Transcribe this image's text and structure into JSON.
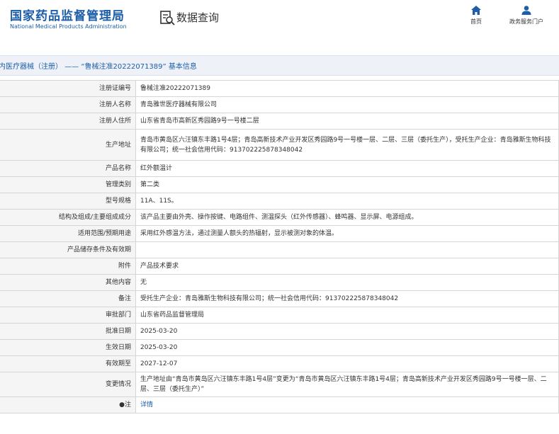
{
  "header": {
    "logo_cn": "国家药品监督管理局",
    "logo_en": "National Medical Products Administration",
    "query_title": "数据查询",
    "nav": [
      {
        "label": "首页",
        "icon": "home-icon"
      },
      {
        "label": "政务服务门户",
        "icon": "user-icon"
      }
    ]
  },
  "breadcrumb": {
    "text": "内医疗器械（注册） —— “鲁械注准20222071389” 基本信息"
  },
  "colors": {
    "brand": "#1c5ea8",
    "label_bg": "#f5f5f5",
    "bar_bg": "#eef2f8"
  },
  "rows": [
    {
      "label": "注册证编号",
      "value": "鲁械注准20222071389"
    },
    {
      "label": "注册人名称",
      "value": "青岛雅世医疗器械有限公司"
    },
    {
      "label": "注册人住所",
      "value": "山东省青岛市高新区秀园路9号一号楼二层"
    },
    {
      "label": "生产地址",
      "value": "青岛市黄岛区六汪镇东丰路1号4层；青岛高新技术产业开发区秀园路9号一号楼一层、二层、三层（委托生产），受托生产企业：青岛雅斯生物科技有限公司；统一社会信用代码：913702225878348042"
    },
    {
      "label": "产品名称",
      "value": "红外额温计"
    },
    {
      "label": "管理类别",
      "value": "第二类"
    },
    {
      "label": "型号规格",
      "value": "11A、11S。"
    },
    {
      "label": "结构及组成/主要组成成分",
      "value": "该产品主要由外壳、操作按键、电路组件、测温探头（红外传感器）、蜂鸣器、显示屏、电源组成。"
    },
    {
      "label": "适用范围/预期用途",
      "value": "采用红外感温方法，通过测量人额头的热辐射，显示被测对象的体温。"
    },
    {
      "label": "产品储存条件及有效期",
      "value": ""
    },
    {
      "label": "附件",
      "value": "产品技术要求"
    },
    {
      "label": "其他内容",
      "value": "无"
    },
    {
      "label": "备注",
      "value": "受托生产企业：青岛雅斯生物科技有限公司；统一社会信用代码：913702225878348042"
    },
    {
      "label": "审批部门",
      "value": "山东省药品监督管理局"
    },
    {
      "label": "批准日期",
      "value": "2025-03-20"
    },
    {
      "label": "生效日期",
      "value": "2025-03-20"
    },
    {
      "label": "有效期至",
      "value": "2027-12-07"
    },
    {
      "label": "变更情况",
      "value": "生产地址由“青岛市黄岛区六汪镇东丰路1号4层”变更为“青岛市黄岛区六汪镇东丰路1号4层；青岛高新技术产业开发区秀园路9号一号楼一层、二层、三层（委托生产）”"
    },
    {
      "label": "●注",
      "value": "详情"
    }
  ]
}
